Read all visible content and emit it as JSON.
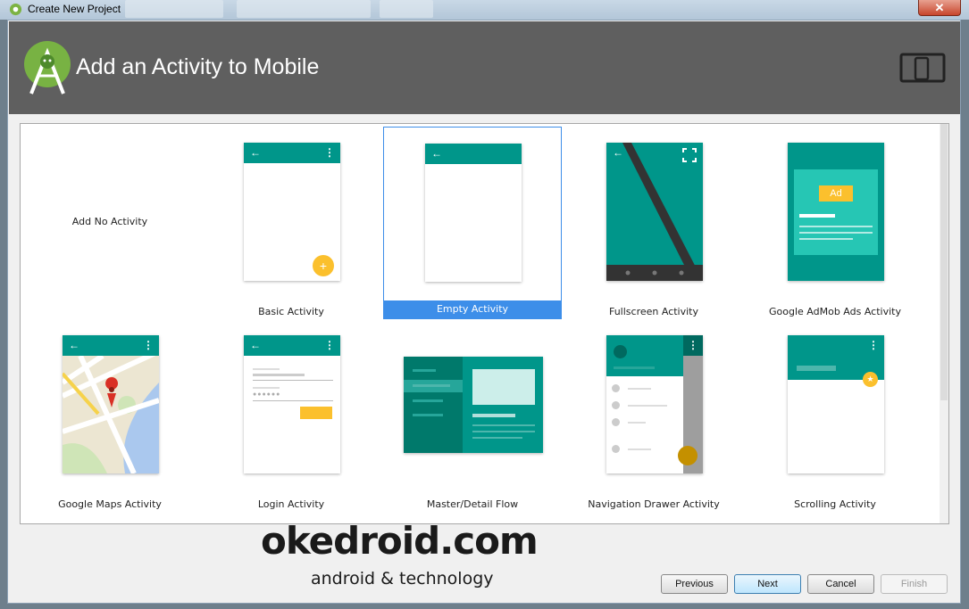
{
  "window": {
    "title": "Create New Project",
    "close_label": "✕"
  },
  "header": {
    "title": "Add an Activity to Mobile"
  },
  "colors": {
    "teal": "#00968a",
    "selected": "#3d8ee9",
    "header_bg": "#5f5f5f",
    "amber": "#fbc02d"
  },
  "templates": [
    {
      "label": "Add No Activity"
    },
    {
      "label": "Basic Activity"
    },
    {
      "label": "Empty Activity",
      "selected": true
    },
    {
      "label": "Fullscreen Activity"
    },
    {
      "label": "Google AdMob Ads Activity",
      "ad_badge": "Ad"
    },
    {
      "label": "Google Maps Activity"
    },
    {
      "label": "Login Activity"
    },
    {
      "label": "Master/Detail Flow"
    },
    {
      "label": "Navigation Drawer Activity"
    },
    {
      "label": "Scrolling Activity"
    }
  ],
  "watermark": {
    "brand": "okedroid.com",
    "tagline": "android & technology"
  },
  "buttons": {
    "previous": "Previous",
    "next": "Next",
    "cancel": "Cancel",
    "finish": "Finish"
  }
}
